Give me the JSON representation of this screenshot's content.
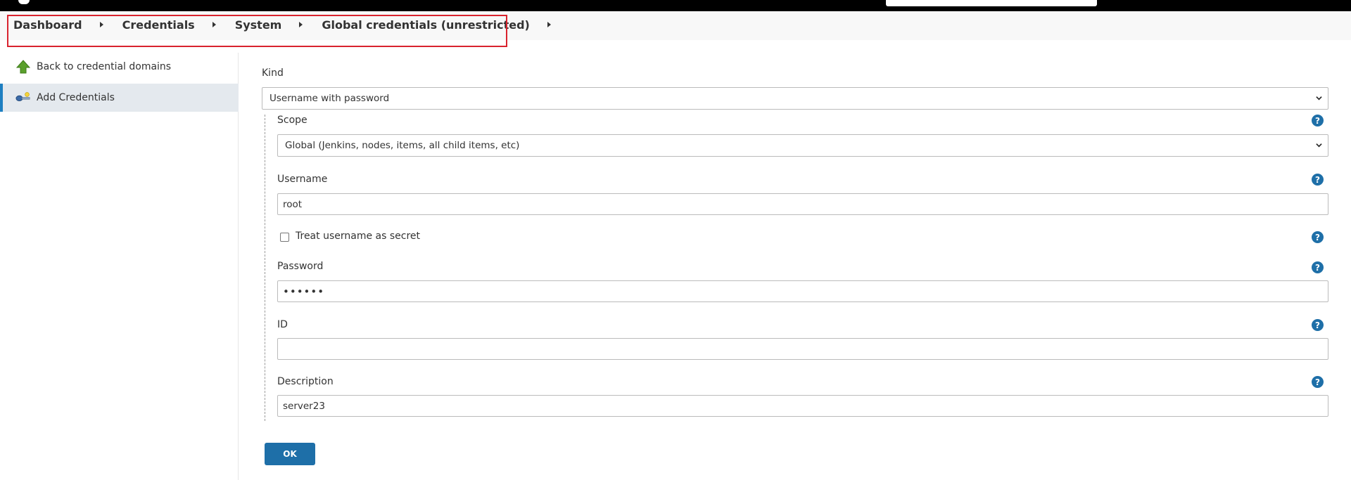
{
  "breadcrumb": {
    "items": [
      "Dashboard",
      "Credentials",
      "System",
      "Global credentials (unrestricted)"
    ]
  },
  "sidebar": {
    "back_label": "Back to credential domains",
    "add_label": "Add Credentials"
  },
  "form": {
    "kind_label": "Kind",
    "kind_value": "Username with password",
    "scope_label": "Scope",
    "scope_value": "Global (Jenkins, nodes, items, all child items, etc)",
    "username_label": "Username",
    "username_value": "root",
    "treat_secret_label": "Treat username as secret",
    "treat_secret_checked": false,
    "password_label": "Password",
    "password_value": "••••••",
    "id_label": "ID",
    "id_value": "",
    "description_label": "Description",
    "description_value": "server23",
    "ok_label": "OK",
    "help_glyph": "?"
  },
  "colors": {
    "accent": "#1e6fa8",
    "highlight": "#d9232e",
    "active_border": "#1d7fc1"
  }
}
